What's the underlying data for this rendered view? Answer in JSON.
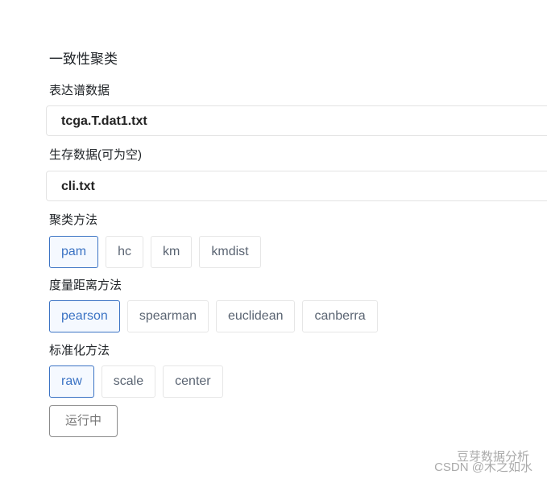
{
  "title": "一致性聚类",
  "expr": {
    "label": "表达谱数据",
    "value": "tcga.T.dat1.txt"
  },
  "surv": {
    "label": "生存数据(可为空)",
    "value": "cli.txt"
  },
  "cluster": {
    "label": "聚类方法",
    "options": [
      "pam",
      "hc",
      "km",
      "kmdist"
    ],
    "selected": "pam"
  },
  "distance": {
    "label": "度量距离方法",
    "options": [
      "pearson",
      "spearman",
      "euclidean",
      "canberra"
    ],
    "selected": "pearson"
  },
  "norm": {
    "label": "标准化方法",
    "options": [
      "raw",
      "scale",
      "center"
    ],
    "selected": "raw"
  },
  "run_label": "运行中",
  "watermark": {
    "line1": "豆芽数据分析",
    "line2": "CSDN @木之如水"
  }
}
